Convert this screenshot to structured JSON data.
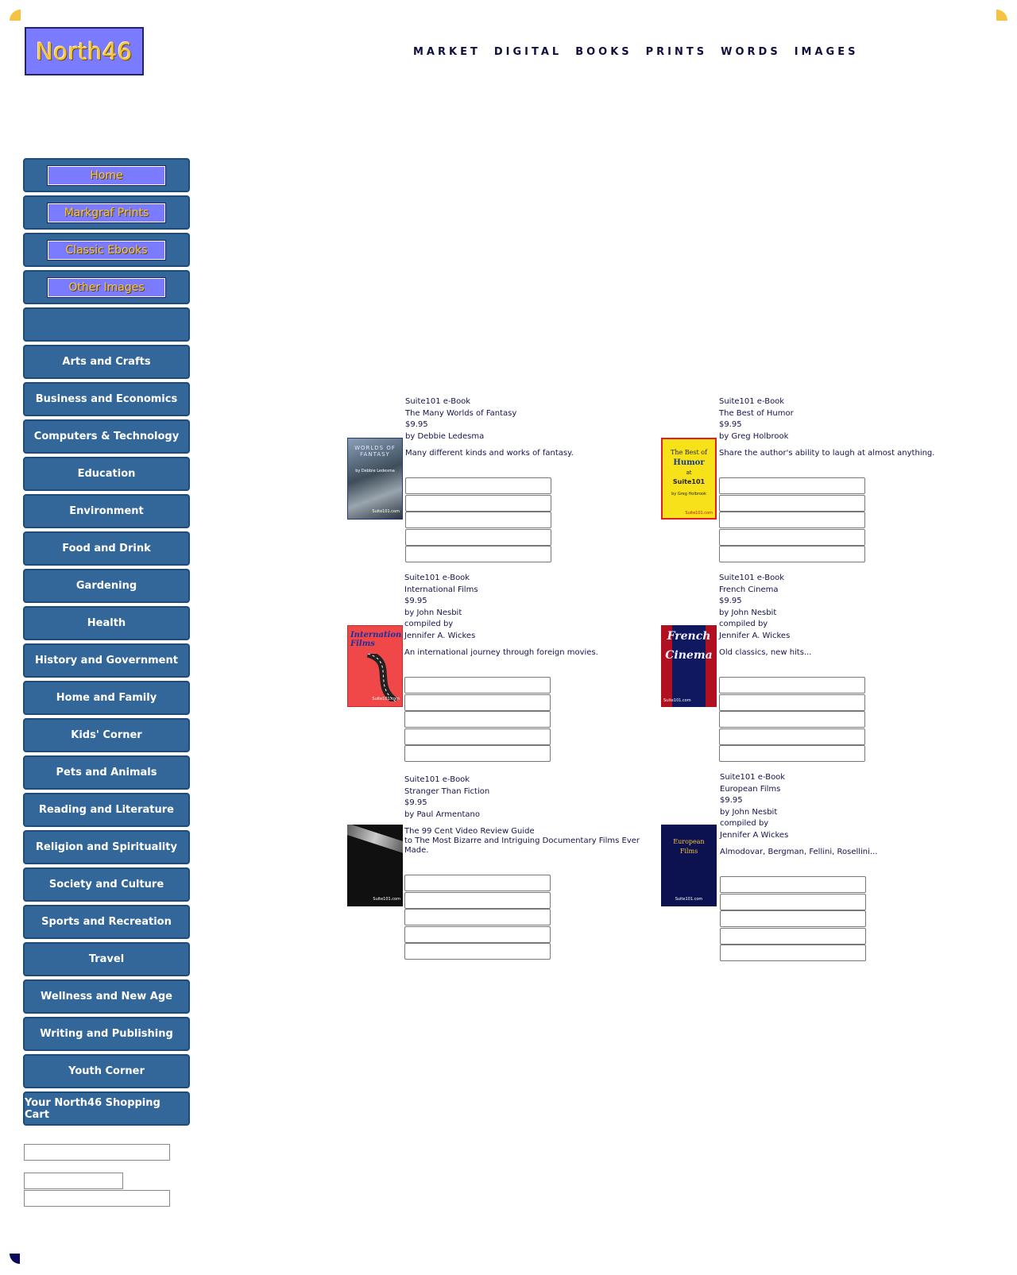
{
  "site": {
    "logo": "North46"
  },
  "topnav": [
    "MARKET",
    "DIGITAL",
    "BOOKS",
    "PRINTS",
    "WORDS",
    "IMAGES"
  ],
  "sidebar": {
    "image_buttons": [
      "Home",
      "Markgraf Prints",
      "Classic Ebooks",
      "Other Images"
    ],
    "categories": [
      "Arts and Crafts",
      "Business and Economics",
      "Computers & Technology",
      "Education",
      "Environment",
      "Food and Drink",
      "Gardening",
      "Health",
      "History and Government",
      "Home and Family",
      "Kids' Corner",
      "Pets and Animals",
      "Reading and Literature",
      "Religion and Spirituality",
      "Society and Culture",
      "Sports and Recreation",
      "Travel",
      "Wellness and New Age",
      "Writing and Publishing",
      "Youth Corner",
      "Your North46 Shopping Cart"
    ]
  },
  "products": [
    {
      "type": "Suite101 e-Book",
      "title": "The Many Worlds of Fantasy",
      "price": "$9.95",
      "author_lines": [
        "by Debbie Ledesma"
      ],
      "desc": "Many different kinds and works of fantasy.",
      "cover": {
        "title": "WORLDS OF FANTASY",
        "sub": "by Debbie Ledesma",
        "brand": "Suite101.com"
      }
    },
    {
      "type": "Suite101 e-Book",
      "title": "The Best of Humor",
      "price": "$9.95",
      "author_lines": [
        "by Greg Holbrook"
      ],
      "desc": "Share the author's ability to laugh at almost anything.",
      "cover": {
        "line1": "The Best of",
        "line2": "Humor",
        "line3": "at",
        "line4": "Suite101",
        "sub": "by Greg Holbrook",
        "brand": "Suite101.com"
      }
    },
    {
      "type": "Suite101 e-Book",
      "title": "International Films",
      "price": "$9.95",
      "author_lines": [
        "by John Nesbit",
        "compiled by",
        "Jennifer A. Wickes"
      ],
      "desc": "An international journey through foreign movies.",
      "cover": {
        "title": "International Films",
        "brand": "Suite101.com"
      }
    },
    {
      "type": "Suite101 e-Book",
      "title": "French Cinema",
      "price": "$9.95",
      "author_lines": [
        "by John Nesbit",
        "compiled by",
        "Jennifer A. Wickes"
      ],
      "desc": "Old classics, new hits...",
      "cover": {
        "line1": "French",
        "line2": "Cinema",
        "brand": "Suite101.com"
      }
    },
    {
      "type": "Suite101 e-Book",
      "title": "Stranger Than Fiction",
      "price": "$9.95",
      "author_lines": [
        "by Paul Armentano"
      ],
      "desc": "The 99 Cent Video Review Guide\nto The Most Bizarre and Intriguing Documentary Films Ever Made.",
      "cover": {
        "brand": "Suite101.com"
      }
    },
    {
      "type": "Suite101 e-Book",
      "title": "European Films",
      "price": "$9.95",
      "author_lines": [
        "by John Nesbit",
        "compiled by",
        "Jennifer A Wickes"
      ],
      "desc": "Almodovar, Bergman, Fellini, Rosellini...",
      "cover": {
        "line1": "European",
        "line2": "Films",
        "brand": "Suite101.com"
      }
    }
  ],
  "colors": {
    "button_bg": "#336699",
    "logo_bg": "#7b7bff",
    "accent_gold": "#f5c242"
  }
}
